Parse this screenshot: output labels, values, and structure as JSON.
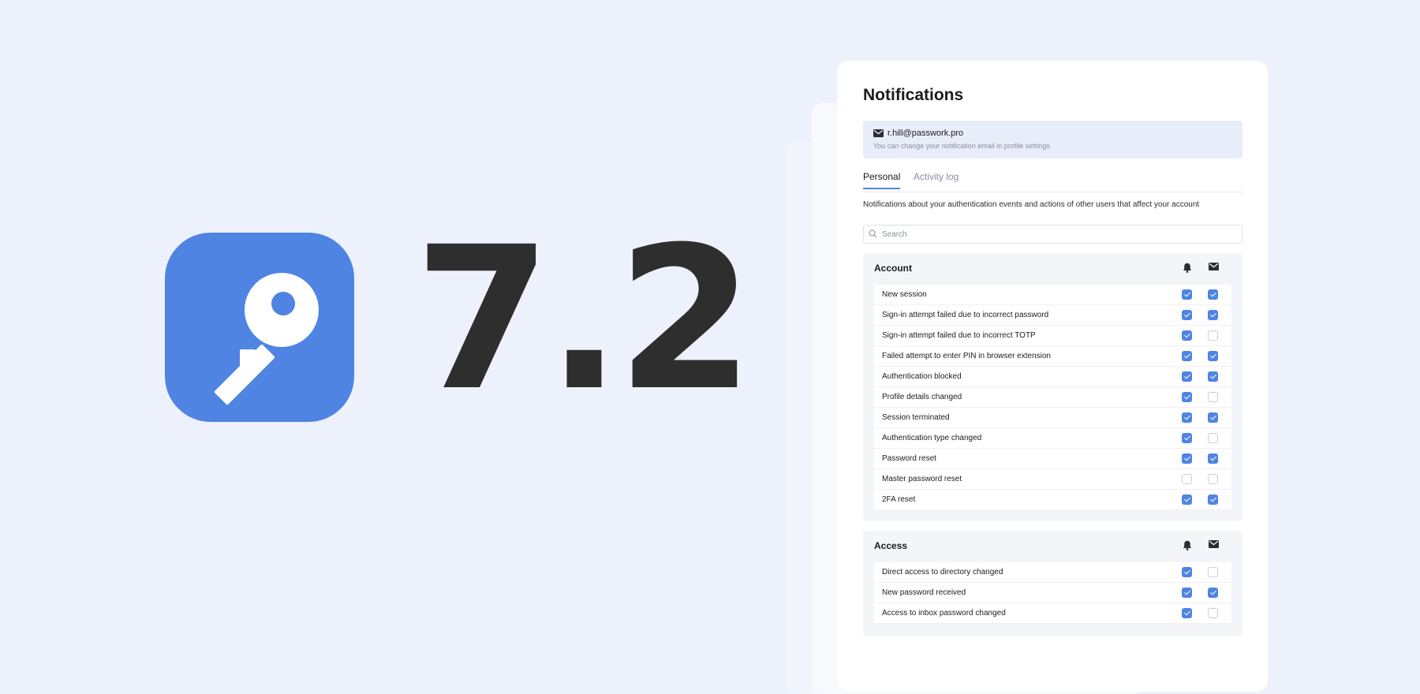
{
  "hero": {
    "icon": "key-icon",
    "version": "7.2",
    "brand_color": "#4f84e3"
  },
  "panel": {
    "title": "Notifications",
    "email": {
      "address": "r.hill@passwork.pro",
      "hint": "You can change your notification email in profile settings"
    },
    "tabs": [
      {
        "label": "Personal",
        "active": true
      },
      {
        "label": "Activity log",
        "active": false
      }
    ],
    "description": "Notifications about your authentication events and actions of other users that affect your account",
    "search": {
      "placeholder": "Search",
      "value": ""
    },
    "column_icons": [
      "bell-icon",
      "mail-icon"
    ],
    "groups": [
      {
        "title": "Account",
        "rows": [
          {
            "label": "New session",
            "app": true,
            "email": true
          },
          {
            "label": "Sign-in attempt failed due to incorrect password",
            "app": true,
            "email": true
          },
          {
            "label": "Sign-in attempt failed due to incorrect TOTP",
            "app": true,
            "email": false
          },
          {
            "label": "Failed attempt to enter PIN in browser extension",
            "app": true,
            "email": true
          },
          {
            "label": "Authentication blocked",
            "app": true,
            "email": true
          },
          {
            "label": "Profile details changed",
            "app": true,
            "email": false
          },
          {
            "label": "Session terminated",
            "app": true,
            "email": true
          },
          {
            "label": "Authentication type changed",
            "app": true,
            "email": false
          },
          {
            "label": "Password reset",
            "app": true,
            "email": true
          },
          {
            "label": "Master password reset",
            "app": false,
            "email": false
          },
          {
            "label": "2FA reset",
            "app": true,
            "email": true
          }
        ]
      },
      {
        "title": "Access",
        "rows": [
          {
            "label": "Direct access to directory changed",
            "app": true,
            "email": false
          },
          {
            "label": "New password received",
            "app": true,
            "email": true
          },
          {
            "label": "Access to inbox password changed",
            "app": true,
            "email": false
          }
        ]
      }
    ]
  }
}
